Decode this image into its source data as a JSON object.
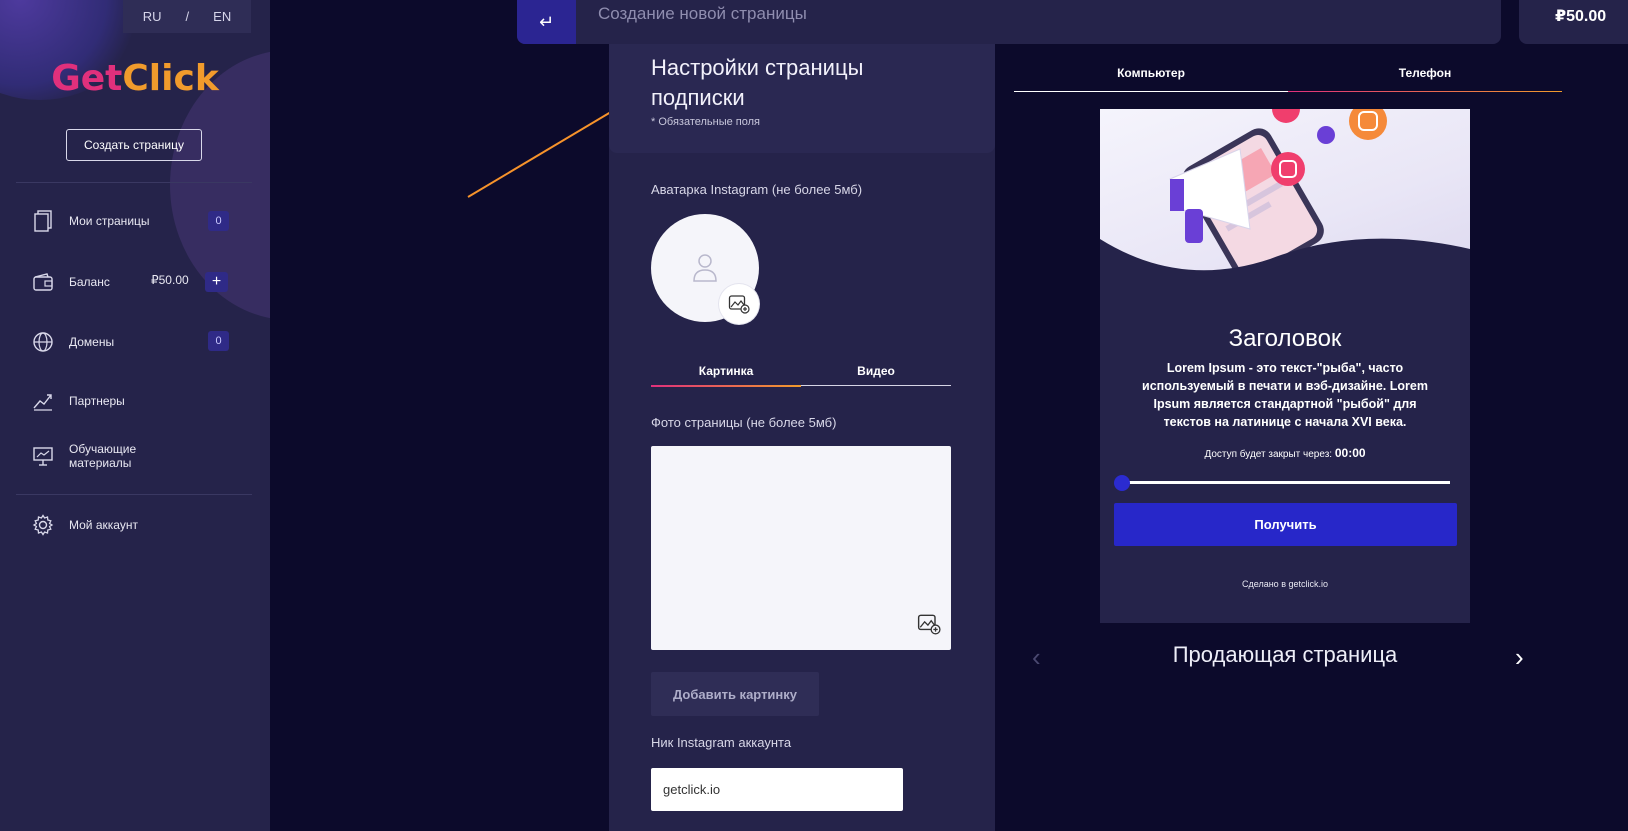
{
  "app": {
    "brand_part1": "Get",
    "brand_part2": "Click"
  },
  "lang": {
    "ru": "RU",
    "sep": "/",
    "en": "EN"
  },
  "sidebar": {
    "create_button": "Создать страницу",
    "items": [
      {
        "label": "Мои страницы",
        "icon": "pages-icon",
        "badge": "0"
      },
      {
        "label": "Баланс",
        "icon": "wallet-icon",
        "value": "₽50.00",
        "action": "+"
      },
      {
        "label": "Домены",
        "icon": "globe-icon",
        "badge": "0"
      },
      {
        "label": "Партнеры",
        "icon": "chart-icon"
      },
      {
        "label": "Обучающие\nматериалы",
        "icon": "presentation-icon"
      },
      {
        "label": "Мой аккаунт",
        "icon": "gear-icon"
      }
    ]
  },
  "topbar": {
    "back_icon": "↵",
    "title": "Создание новой страницы",
    "balance": "₽50.00"
  },
  "form": {
    "title": "Настройки страницы подписки",
    "required_note": "* Обязательные поля",
    "avatar_label": "Аватарка Instagram (не более 5мб)",
    "tabs": [
      "Картинка",
      "Видео"
    ],
    "photo_label": "Фото страницы (не более 5мб)",
    "add_picture_button": "Добавить картинку",
    "nick_label": "Ник Instagram аккаунта",
    "nick_value": "getclick.io"
  },
  "preview": {
    "tabs": [
      "Компьютер",
      "Телефон"
    ],
    "heading": "Заголовок",
    "text": "Lorem Ipsum - это текст-\"рыба\", часто используемый в печати и вэб-дизайне. Lorem Ipsum является стандартной \"рыбой\" для текстов на латинице с начала XVI века.",
    "timer_label": "Доступ будет закрыт через:",
    "timer_value": "00:00",
    "button": "Получить",
    "made_in": "Сделано в getclick.io",
    "carousel_title": "Продающая страница",
    "prev_arrow": "‹",
    "next_arrow": "›"
  },
  "colors": {
    "accent_blue": "#2727c9",
    "brand_pink": "#e0307c",
    "brand_orange": "#f19b2c",
    "annotation_arrow": "#f7932b"
  }
}
